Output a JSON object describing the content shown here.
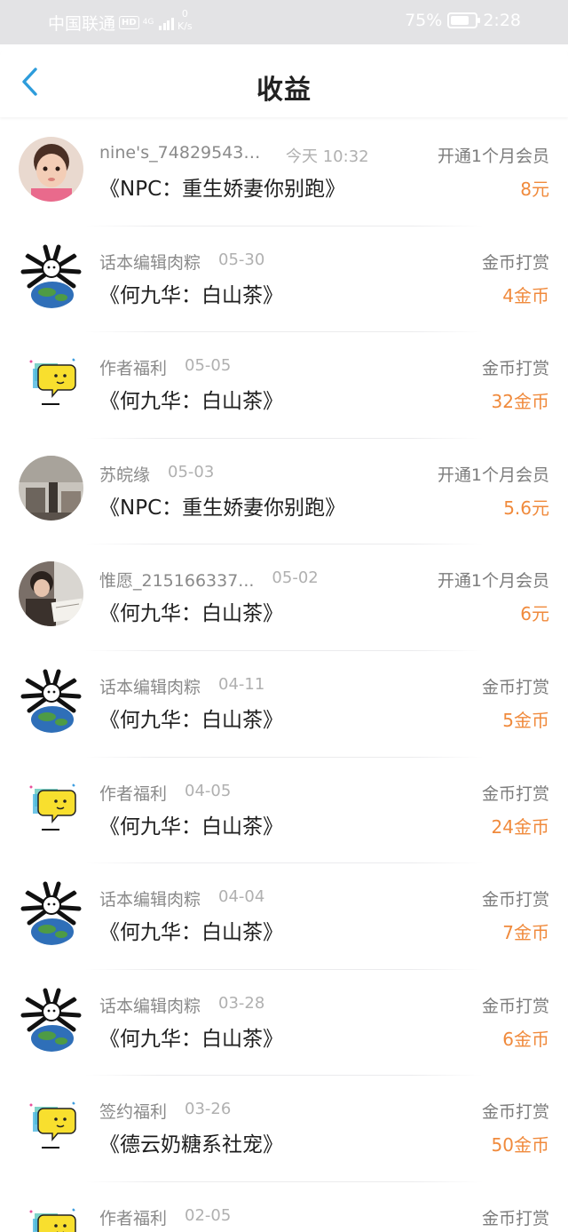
{
  "status_bar": {
    "carrier": "中国联通",
    "hd": "HD",
    "network": "4G",
    "speed_value": "0",
    "speed_unit": "K/s",
    "battery": "75%",
    "time": "2:28"
  },
  "header": {
    "title": "收益",
    "back_icon": "chevron-left-icon"
  },
  "colors": {
    "accent": "#2d9cdb",
    "amount": "#f08a3c",
    "title": "#222222",
    "secondary_text": "#8a8a8a"
  },
  "items": [
    {
      "user": "nine's_748295438...",
      "date": "今天 10:32",
      "book": "《NPC：重生娇妻你别跑》",
      "type": "开通1个月会员",
      "amount": "8元",
      "avatar": "photo-child"
    },
    {
      "user": "话本编辑肉粽",
      "date": "05-30",
      "book": "《何九华：白山茶》",
      "type": "金币打赏",
      "amount": "4金币",
      "avatar": "meme-earth"
    },
    {
      "user": "作者福利",
      "date": "05-05",
      "book": "《何九华：白山茶》",
      "type": "金币打赏",
      "amount": "32金币",
      "avatar": "meme-bubble"
    },
    {
      "user": "苏皖缘",
      "date": "05-03",
      "book": "《NPC：重生娇妻你别跑》",
      "type": "开通1个月会员",
      "amount": "5.6元",
      "avatar": "photo-room"
    },
    {
      "user": "惟愿_215166337...",
      "date": "05-02",
      "book": "《何九华：白山茶》",
      "type": "开通1个月会员",
      "amount": "6元",
      "avatar": "photo-desk"
    },
    {
      "user": "话本编辑肉粽",
      "date": "04-11",
      "book": "《何九华：白山茶》",
      "type": "金币打赏",
      "amount": "5金币",
      "avatar": "meme-earth"
    },
    {
      "user": "作者福利",
      "date": "04-05",
      "book": "《何九华：白山茶》",
      "type": "金币打赏",
      "amount": "24金币",
      "avatar": "meme-bubble"
    },
    {
      "user": "话本编辑肉粽",
      "date": "04-04",
      "book": "《何九华：白山茶》",
      "type": "金币打赏",
      "amount": "7金币",
      "avatar": "meme-earth"
    },
    {
      "user": "话本编辑肉粽",
      "date": "03-28",
      "book": "《何九华：白山茶》",
      "type": "金币打赏",
      "amount": "6金币",
      "avatar": "meme-earth"
    },
    {
      "user": "签约福利",
      "date": "03-26",
      "book": "《德云奶糖系社宠》",
      "type": "金币打赏",
      "amount": "50金币",
      "avatar": "meme-bubble"
    },
    {
      "user": "作者福利",
      "date": "02-05",
      "book": "",
      "type": "金币打赏",
      "amount": "",
      "avatar": "meme-bubble"
    }
  ]
}
